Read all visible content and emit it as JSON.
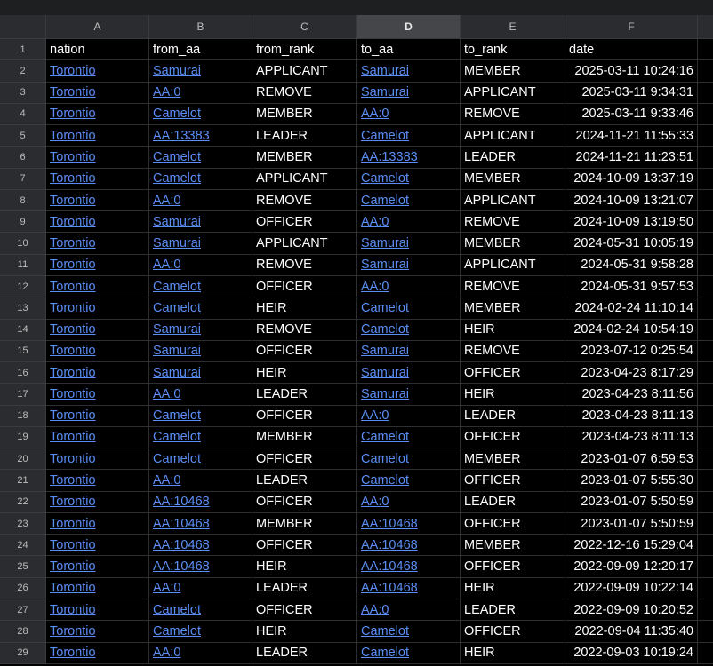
{
  "columns": [
    "A",
    "B",
    "C",
    "D",
    "E",
    "F"
  ],
  "active_column": "D",
  "header_row": {
    "num": "1",
    "cells": [
      "nation",
      "from_aa",
      "from_rank",
      "to_aa",
      "to_rank",
      "date"
    ]
  },
  "rows": [
    {
      "num": "2",
      "nation": "Torontio",
      "from_aa": "Samurai",
      "from_rank": "APPLICANT",
      "to_aa": "Samurai",
      "to_rank": "MEMBER",
      "date": "2025-03-11 10:24:16"
    },
    {
      "num": "3",
      "nation": "Torontio",
      "from_aa": "AA:0",
      "from_rank": "REMOVE",
      "to_aa": "Samurai",
      "to_rank": "APPLICANT",
      "date": "2025-03-11 9:34:31"
    },
    {
      "num": "4",
      "nation": "Torontio",
      "from_aa": "Camelot",
      "from_rank": "MEMBER",
      "to_aa": "AA:0",
      "to_rank": "REMOVE",
      "date": "2025-03-11 9:33:46"
    },
    {
      "num": "5",
      "nation": "Torontio",
      "from_aa": "AA:13383",
      "from_rank": "LEADER",
      "to_aa": "Camelot",
      "to_rank": "APPLICANT",
      "date": "2024-11-21 11:55:33"
    },
    {
      "num": "6",
      "nation": "Torontio",
      "from_aa": "Camelot",
      "from_rank": "MEMBER",
      "to_aa": "AA:13383",
      "to_rank": "LEADER",
      "date": "2024-11-21 11:23:51"
    },
    {
      "num": "7",
      "nation": "Torontio",
      "from_aa": "Camelot",
      "from_rank": "APPLICANT",
      "to_aa": "Camelot",
      "to_rank": "MEMBER",
      "date": "2024-10-09 13:37:19"
    },
    {
      "num": "8",
      "nation": "Torontio",
      "from_aa": "AA:0",
      "from_rank": "REMOVE",
      "to_aa": "Camelot",
      "to_rank": "APPLICANT",
      "date": "2024-10-09 13:21:07"
    },
    {
      "num": "9",
      "nation": "Torontio",
      "from_aa": "Samurai",
      "from_rank": "OFFICER",
      "to_aa": "AA:0",
      "to_rank": "REMOVE",
      "date": "2024-10-09 13:19:50"
    },
    {
      "num": "10",
      "nation": "Torontio",
      "from_aa": "Samurai",
      "from_rank": "APPLICANT",
      "to_aa": "Samurai",
      "to_rank": "MEMBER",
      "date": "2024-05-31 10:05:19"
    },
    {
      "num": "11",
      "nation": "Torontio",
      "from_aa": "AA:0",
      "from_rank": "REMOVE",
      "to_aa": "Samurai",
      "to_rank": "APPLICANT",
      "date": "2024-05-31 9:58:28"
    },
    {
      "num": "12",
      "nation": "Torontio",
      "from_aa": "Camelot",
      "from_rank": "OFFICER",
      "to_aa": "AA:0",
      "to_rank": "REMOVE",
      "date": "2024-05-31 9:57:53"
    },
    {
      "num": "13",
      "nation": "Torontio",
      "from_aa": "Camelot",
      "from_rank": "HEIR",
      "to_aa": "Camelot",
      "to_rank": "MEMBER",
      "date": "2024-02-24 11:10:14"
    },
    {
      "num": "14",
      "nation": "Torontio",
      "from_aa": "Samurai",
      "from_rank": "REMOVE",
      "to_aa": "Camelot",
      "to_rank": "HEIR",
      "date": "2024-02-24 10:54:19"
    },
    {
      "num": "15",
      "nation": "Torontio",
      "from_aa": "Samurai",
      "from_rank": "OFFICER",
      "to_aa": "Samurai",
      "to_rank": "REMOVE",
      "date": "2023-07-12 0:25:54"
    },
    {
      "num": "16",
      "nation": "Torontio",
      "from_aa": "Samurai",
      "from_rank": "HEIR",
      "to_aa": "Samurai",
      "to_rank": "OFFICER",
      "date": "2023-04-23 8:17:29"
    },
    {
      "num": "17",
      "nation": "Torontio",
      "from_aa": "AA:0",
      "from_rank": "LEADER",
      "to_aa": "Samurai",
      "to_rank": "HEIR",
      "date": "2023-04-23 8:11:56"
    },
    {
      "num": "18",
      "nation": "Torontio",
      "from_aa": "Camelot",
      "from_rank": "OFFICER",
      "to_aa": "AA:0",
      "to_rank": "LEADER",
      "date": "2023-04-23 8:11:13"
    },
    {
      "num": "19",
      "nation": "Torontio",
      "from_aa": "Camelot",
      "from_rank": "MEMBER",
      "to_aa": "Camelot",
      "to_rank": "OFFICER",
      "date": "2023-04-23 8:11:13"
    },
    {
      "num": "20",
      "nation": "Torontio",
      "from_aa": "Camelot",
      "from_rank": "OFFICER",
      "to_aa": "Camelot",
      "to_rank": "MEMBER",
      "date": "2023-01-07 6:59:53"
    },
    {
      "num": "21",
      "nation": "Torontio",
      "from_aa": "AA:0",
      "from_rank": "LEADER",
      "to_aa": "Camelot",
      "to_rank": "OFFICER",
      "date": "2023-01-07 5:55:30"
    },
    {
      "num": "22",
      "nation": "Torontio",
      "from_aa": "AA:10468",
      "from_rank": "OFFICER",
      "to_aa": "AA:0",
      "to_rank": "LEADER",
      "date": "2023-01-07 5:50:59"
    },
    {
      "num": "23",
      "nation": "Torontio",
      "from_aa": "AA:10468",
      "from_rank": "MEMBER",
      "to_aa": "AA:10468",
      "to_rank": "OFFICER",
      "date": "2023-01-07 5:50:59"
    },
    {
      "num": "24",
      "nation": "Torontio",
      "from_aa": "AA:10468",
      "from_rank": "OFFICER",
      "to_aa": "AA:10468",
      "to_rank": "MEMBER",
      "date": "2022-12-16 15:29:04"
    },
    {
      "num": "25",
      "nation": "Torontio",
      "from_aa": "AA:10468",
      "from_rank": "HEIR",
      "to_aa": "AA:10468",
      "to_rank": "OFFICER",
      "date": "2022-09-09 12:20:17"
    },
    {
      "num": "26",
      "nation": "Torontio",
      "from_aa": "AA:0",
      "from_rank": "LEADER",
      "to_aa": "AA:10468",
      "to_rank": "HEIR",
      "date": "2022-09-09 10:22:14"
    },
    {
      "num": "27",
      "nation": "Torontio",
      "from_aa": "Camelot",
      "from_rank": "OFFICER",
      "to_aa": "AA:0",
      "to_rank": "LEADER",
      "date": "2022-09-09 10:20:52"
    },
    {
      "num": "28",
      "nation": "Torontio",
      "from_aa": "Camelot",
      "from_rank": "HEIR",
      "to_aa": "Camelot",
      "to_rank": "OFFICER",
      "date": "2022-09-04 11:35:40"
    },
    {
      "num": "29",
      "nation": "Torontio",
      "from_aa": "AA:0",
      "from_rank": "LEADER",
      "to_aa": "Camelot",
      "to_rank": "HEIR",
      "date": "2022-09-03 10:19:24"
    }
  ],
  "colors": {
    "background": "#000000",
    "header_bg": "#2b2c2f",
    "link": "#5b8ef5",
    "text": "#ffffff"
  }
}
